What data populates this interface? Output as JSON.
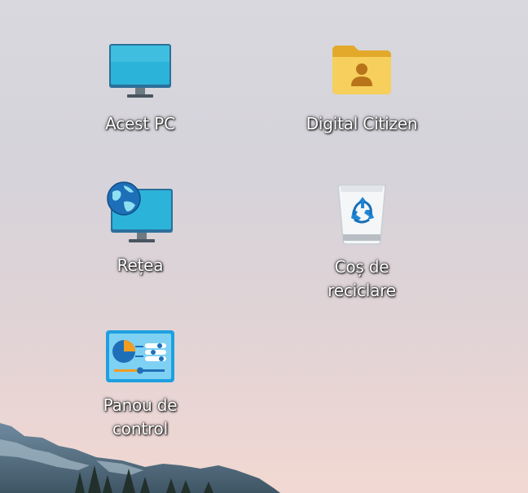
{
  "desktop": {
    "icons": [
      {
        "id": "this-pc",
        "label": "Acest PC",
        "icon": "computer-monitor-icon"
      },
      {
        "id": "user-folder",
        "label": "Digital Citizen",
        "icon": "user-folder-icon"
      },
      {
        "id": "network",
        "label": "Rețea",
        "icon": "network-globe-icon"
      },
      {
        "id": "recycle-bin",
        "label": "Coș de\nreciclare",
        "icon": "recycle-bin-icon"
      },
      {
        "id": "control-panel",
        "label": "Panou de\ncontrol",
        "icon": "control-panel-icon"
      }
    ]
  },
  "colors": {
    "label_text": "#ffffff",
    "monitor_screen": "#2bb3d9",
    "folder": "#f2c94c",
    "control_panel": "#1ea0e0"
  }
}
